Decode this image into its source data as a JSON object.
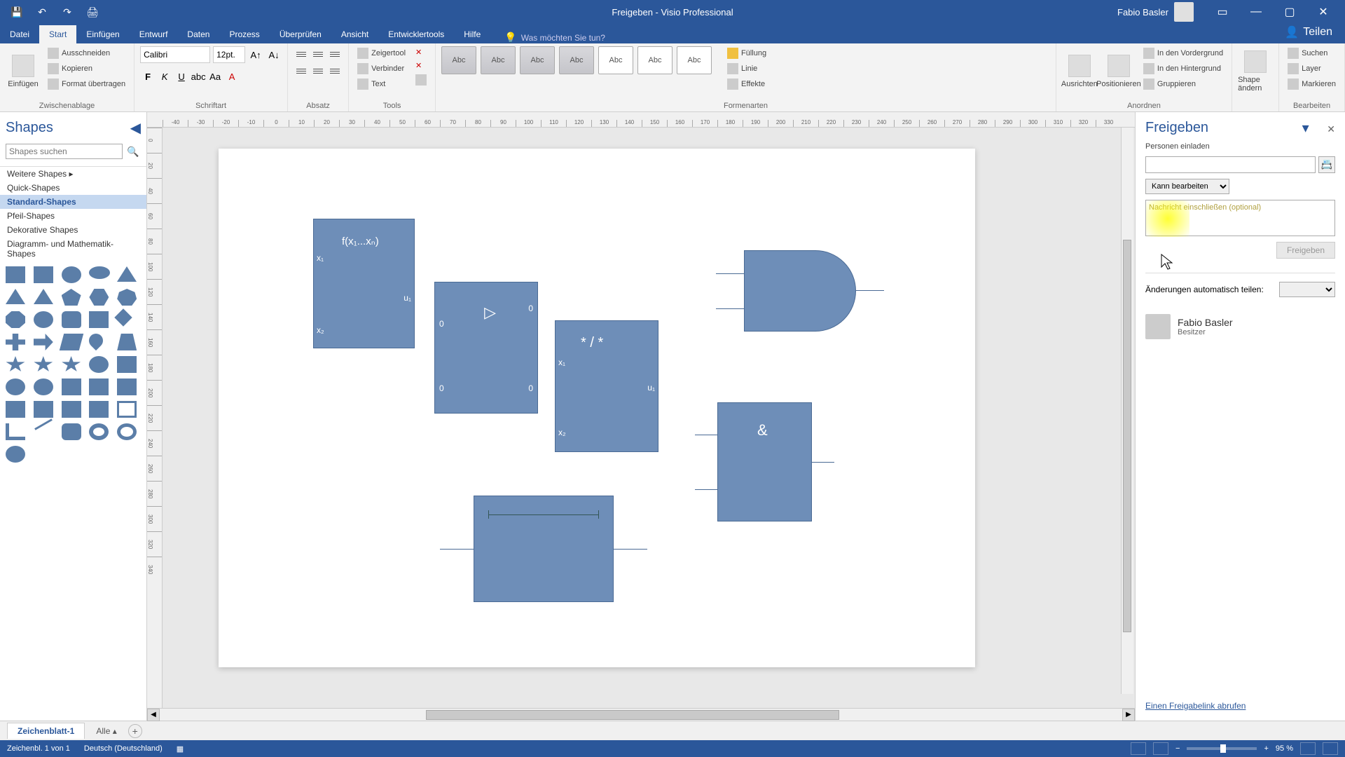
{
  "title": "Freigeben - Visio Professional",
  "user": {
    "name": "Fabio Basler"
  },
  "qat": {
    "save": "💾",
    "undo": "↶",
    "redo": "↷",
    "print": "🖨"
  },
  "tabs": {
    "datei": "Datei",
    "start": "Start",
    "einfuegen": "Einfügen",
    "entwurf": "Entwurf",
    "daten": "Daten",
    "prozess": "Prozess",
    "ueberpruefen": "Überprüfen",
    "ansicht": "Ansicht",
    "entwicklertools": "Entwicklertools",
    "hilfe": "Hilfe"
  },
  "tellme": {
    "label": "Was möchten Sie tun?"
  },
  "shareTab": {
    "label": "Teilen"
  },
  "ribbon": {
    "zwischenablage": {
      "label": "Zwischenablage",
      "einfuegen": "Einfügen",
      "ausschneiden": "Ausschneiden",
      "kopieren": "Kopieren",
      "format": "Format übertragen"
    },
    "schriftart": {
      "label": "Schriftart",
      "font": "Calibri",
      "size": "12pt."
    },
    "absatz": {
      "label": "Absatz"
    },
    "tools": {
      "label": "Tools",
      "zeiger": "Zeigertool",
      "verbinder": "Verbinder",
      "text": "Text"
    },
    "formen": {
      "label": "Formenarten",
      "abc": "Abc"
    },
    "shapeformat": {
      "label": " ",
      "fuellung": "Füllung",
      "linie": "Linie",
      "effekte": "Effekte"
    },
    "anordnen": {
      "label": "Anordnen",
      "ausrichten": "Ausrichten",
      "positionieren": "Positionieren",
      "vordergrund": "In den Vordergrund",
      "hintergrund": "In den Hintergrund",
      "gruppieren": "Gruppieren"
    },
    "shape": {
      "label": " ",
      "aendern": "Shape ändern"
    },
    "bearbeiten": {
      "label": "Bearbeiten",
      "suchen": "Suchen",
      "layer": "Layer",
      "markieren": "Markieren"
    }
  },
  "shapesPanel": {
    "title": "Shapes",
    "searchPlaceholder": "Shapes suchen",
    "cats": {
      "weitere": "Weitere Shapes",
      "quick": "Quick-Shapes",
      "standard": "Standard-Shapes",
      "pfeil": "Pfeil-Shapes",
      "dekorative": "Dekorative Shapes",
      "diagramm": "Diagramm- und Mathematik-Shapes"
    }
  },
  "canvas": {
    "shape1": {
      "fx": "f(x₁...xₙ)",
      "x1": "x₁",
      "x2": "x₂",
      "u1": "u₁"
    },
    "shape2": {
      "tl": "0",
      "tr": "0",
      "bl": "0",
      "br": "0"
    },
    "shape3": {
      "op": "* / *",
      "x1": "x₁",
      "x2": "x₂",
      "u1": "u₁"
    },
    "shape5": {
      "amp": "&"
    }
  },
  "sharePane": {
    "title": "Freigeben",
    "invite": "Personen einladen",
    "perm": "Kann bearbeiten",
    "msgPlaceholder": "Nachricht einschließen (optional)",
    "submit": "Freigeben",
    "autoShare": "Änderungen automatisch teilen:",
    "person": {
      "name": "Fabio Basler",
      "role": "Besitzer"
    },
    "getLink": "Einen Freigabelink abrufen"
  },
  "sheet": {
    "tab1": "Zeichenblatt-1",
    "alle": "Alle"
  },
  "status": {
    "page": "Zeichenbl. 1 von 1",
    "lang": "Deutsch (Deutschland)",
    "zoom": "95 %"
  },
  "ruler": [
    "-40",
    "-30",
    "-20",
    "-10",
    "0",
    "10",
    "20",
    "30",
    "40",
    "50",
    "60",
    "70",
    "80",
    "90",
    "100",
    "110",
    "120",
    "130",
    "140",
    "150",
    "160",
    "170",
    "180",
    "190",
    "200",
    "210",
    "220",
    "230",
    "240",
    "250",
    "260",
    "270",
    "280",
    "290",
    "300",
    "310",
    "320",
    "330"
  ],
  "rulerV": [
    "0",
    "20",
    "40",
    "60",
    "80",
    "100",
    "120",
    "140",
    "160",
    "180",
    "200",
    "220",
    "240",
    "260",
    "280",
    "300",
    "320",
    "340"
  ]
}
